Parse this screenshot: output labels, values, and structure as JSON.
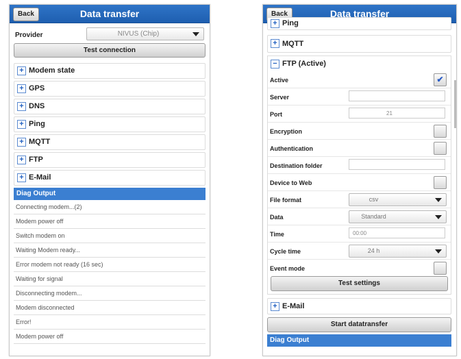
{
  "left": {
    "header": {
      "back_label": "Back",
      "title": "Data transfer"
    },
    "provider": {
      "label": "Provider",
      "value": "NIVUS (Chip)"
    },
    "test_connection_label": "Test connection",
    "sections": [
      "Modem state",
      "GPS",
      "DNS",
      "Ping",
      "MQTT",
      "FTP",
      "E-Mail"
    ],
    "diag": {
      "title": "Diag Output",
      "lines": [
        "Connecting modem...(2)",
        "Modem power off",
        "Switch modem on",
        "Waiting Modem ready...",
        "Error modem not ready (16 sec)",
        "Waiting for signal",
        "Disconnecting modem...",
        "Modem disconnected",
        "Error!",
        "Modem power off"
      ]
    }
  },
  "right": {
    "header": {
      "back_label": "Back",
      "title": "Data transfer"
    },
    "sections_top": [
      "Ping",
      "MQTT"
    ],
    "ftp": {
      "section_label": "FTP (Active)",
      "active": {
        "label": "Active",
        "checked": "✔"
      },
      "server": {
        "label": "Server",
        "value": ""
      },
      "port": {
        "label": "Port",
        "value": "21"
      },
      "encryption": {
        "label": "Encryption"
      },
      "authentication": {
        "label": "Authentication"
      },
      "destination_folder": {
        "label": "Destination folder",
        "value": ""
      },
      "device_to_web": {
        "label": "Device to Web"
      },
      "file_format": {
        "label": "File format",
        "value": "csv"
      },
      "data": {
        "label": "Data",
        "value": "Standard"
      },
      "time": {
        "label": "Time",
        "value": "00:00"
      },
      "cycle_time": {
        "label": "Cycle time",
        "value": "24 h"
      },
      "event_mode": {
        "label": "Event mode"
      },
      "test_settings_label": "Test settings"
    },
    "email_label": "E-Mail",
    "start_label": "Start datatransfer",
    "diag_title": "Diag Output"
  },
  "colors": {
    "header": "#1e5fb0",
    "diag_header": "#3b7fd1",
    "plus": "#1f5fc0"
  }
}
